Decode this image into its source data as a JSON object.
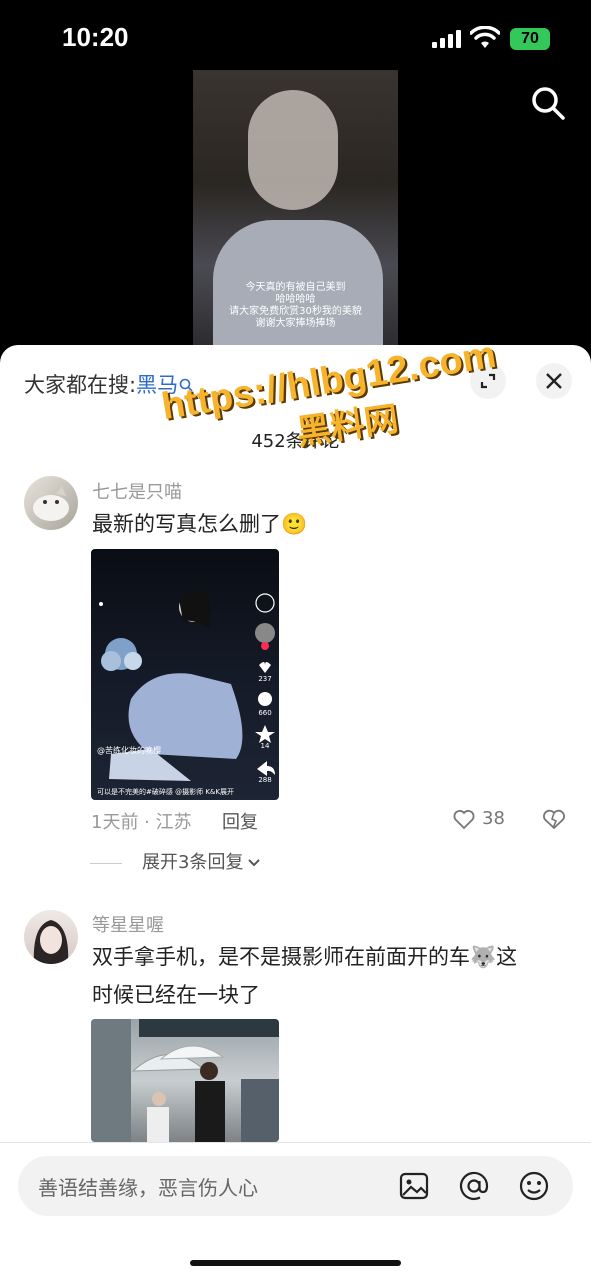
{
  "status_bar": {
    "time": "10:20",
    "battery": "70"
  },
  "video": {
    "caption_lines": [
      "今天真的有被自己美到",
      "哈哈哈哈",
      "请大家免费欣赏30秒我的美貌",
      "谢谢大家捧场捧场"
    ]
  },
  "sheet": {
    "search_prefix": "大家都在搜:",
    "search_keyword": "黑马",
    "comment_count": "452条评论"
  },
  "watermark": {
    "line1": "https://hlbg12.com",
    "line2": "黑料网"
  },
  "comments": [
    {
      "username": "七七是只喵",
      "text": "最新的写真怎么删了🙂",
      "image_overlay": {
        "author": "@苦练化妆的晚樱",
        "caption": "可以是不完美的#破碎感 @摄影师 K&K展开",
        "likes": "237",
        "comments": "660",
        "stars": "14",
        "shares": "288"
      },
      "time_location": "1天前 · 江苏",
      "reply": "回复",
      "likes": "38",
      "expand_replies": "展开3条回复"
    },
    {
      "username": "等星星喔",
      "text_line1": "双手拿手机，是不是摄影师在前面开的车🐺这",
      "text_line2": "时候已经在一块了"
    }
  ],
  "input": {
    "placeholder": "善语结善缘，恶言伤人心"
  }
}
